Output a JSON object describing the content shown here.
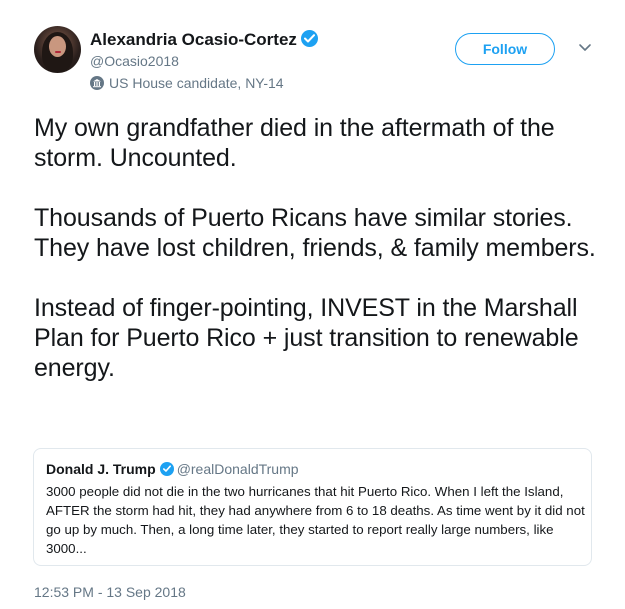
{
  "author": {
    "name": "Alexandria Ocasio-Cortez",
    "handle": "@Ocasio2018",
    "label": "US House candidate, NY-14",
    "avatar_icon": "profile-photo",
    "verified": true
  },
  "follow_button": {
    "label": "Follow"
  },
  "more_menu_icon": "chevron-down-icon",
  "tweet": {
    "paragraphs": [
      "My own grandfather died in the aftermath of the storm. Uncounted.",
      "Thousands of Puerto Ricans have similar stories. They have lost children, friends, & family members.",
      "Instead of finger-pointing, INVEST in the Marshall Plan for Puerto Rico + just transition to renewable energy."
    ],
    "timestamp": "12:53 PM - 13 Sep 2018"
  },
  "quoted_tweet": {
    "name": "Donald J. Trump",
    "handle": "@realDonaldTrump",
    "verified": true,
    "text": "3000 people did not die in the two hurricanes that hit Puerto Rico. When I left the Island, AFTER the storm had hit, they had anywhere from 6 to 18 deaths. As time went by it did not go up by much. Then, a long time later, they started to report really large numbers, like 3000..."
  },
  "colors": {
    "accent": "#1da1f2",
    "text_primary": "#14171a",
    "text_secondary": "#657786",
    "border": "#e1e8ed"
  }
}
